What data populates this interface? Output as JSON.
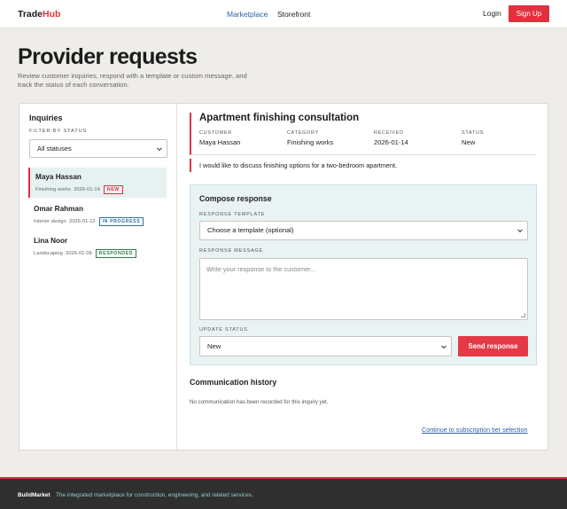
{
  "header": {
    "brand_prefix": "Trade",
    "brand_suffix": "Hub",
    "nav": [
      "Marketplace",
      "Storefront"
    ],
    "login": "Login",
    "signup": "Sign Up"
  },
  "page": {
    "title": "Provider requests",
    "subtitle": "Review customer inquiries, respond with a template or custom message, and track the status of each conversation."
  },
  "inquiries": {
    "title": "Inquiries",
    "filter_label": "FILTER BY STATUS",
    "filter_value": "All statuses",
    "items": [
      {
        "name": "Maya Hassan",
        "category": "Finishing works",
        "date": "2026-01-14",
        "status": "NEW"
      },
      {
        "name": "Omar Rahman",
        "category": "Interior design",
        "date": "2026-01-12",
        "status": "IN PROGRESS"
      },
      {
        "name": "Lina Noor",
        "category": "Landscaping",
        "date": "2026-01-09",
        "status": "RESPONDED"
      }
    ]
  },
  "detail": {
    "title": "Apartment finishing consultation",
    "fields": [
      {
        "label": "CUSTOMER",
        "value": "Maya Hassan"
      },
      {
        "label": "CATEGORY",
        "value": "Finishing works"
      },
      {
        "label": "RECEIVED",
        "value": "2026-01-14"
      },
      {
        "label": "STATUS",
        "value": "New"
      }
    ],
    "message": "I would like to discuss finishing options for a two-bedroom apartment."
  },
  "compose": {
    "title": "Compose response",
    "template_label": "RESPONSE TEMPLATE",
    "template_value": "Choose a template (optional)",
    "message_label": "RESPONSE MESSAGE",
    "message_placeholder": "Write your response to the customer...",
    "status_label": "UPDATE STATUS",
    "status_value": "New",
    "send": "Send response"
  },
  "history": {
    "title": "Communication history",
    "empty": "No communication has been recorded for this inquiry yet.",
    "continue": "Continue to subscription tier selection"
  },
  "footer": {
    "brand": "BuildMarket",
    "tagline": "The integrated marketplace for construction, engineering, and related services."
  }
}
